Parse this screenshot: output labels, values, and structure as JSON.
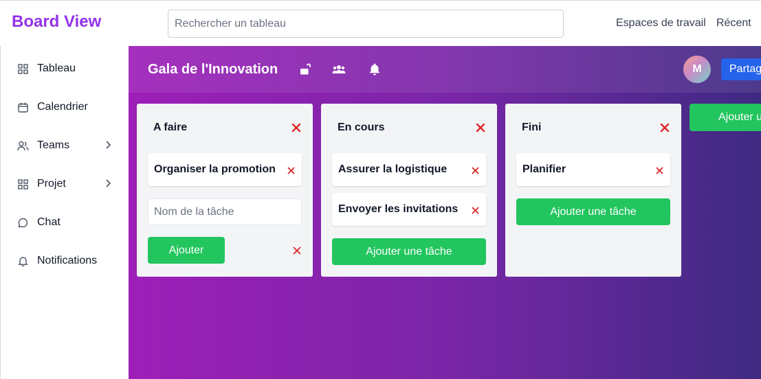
{
  "app": {
    "brand": "Board View"
  },
  "search": {
    "placeholder": "Rechercher un tableau"
  },
  "topnav": {
    "workspaces": "Espaces de travail",
    "recent": "Récent"
  },
  "sidebar": {
    "items": [
      {
        "label": "Tableau",
        "icon": "grid-icon",
        "has_chevron": false
      },
      {
        "label": "Calendrier",
        "icon": "calendar-icon",
        "has_chevron": false
      },
      {
        "label": "Teams",
        "icon": "users-icon",
        "has_chevron": true
      },
      {
        "label": "Projet",
        "icon": "grid-icon",
        "has_chevron": true
      },
      {
        "label": "Chat",
        "icon": "chat-icon",
        "has_chevron": false
      },
      {
        "label": "Notifications",
        "icon": "bell-icon",
        "has_chevron": false
      }
    ]
  },
  "board": {
    "title": "Gala de l'Innovation",
    "avatar_initial": "M",
    "share_label": "Partager",
    "add_list_label": "Ajouter une liste",
    "lists": [
      {
        "title": "A faire",
        "cards": [
          "Organiser la promotion"
        ],
        "input_placeholder": "Nom de la tâche",
        "add_label": "Ajouter"
      },
      {
        "title": "En cours",
        "cards": [
          "Assurer la logistique",
          "Envoyer les invitations"
        ],
        "add_task_label": "Ajouter une tâche"
      },
      {
        "title": "Fini",
        "cards": [
          "Planifier"
        ],
        "add_task_label": "Ajouter une tâche"
      }
    ]
  },
  "colors": {
    "brand": "#9333ea",
    "accent_green": "#22c55e",
    "delete_red": "#dc2626",
    "share_blue": "#2563eb"
  }
}
